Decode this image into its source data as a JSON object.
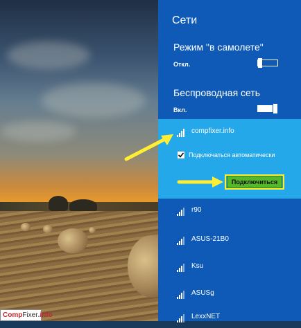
{
  "panel": {
    "title": "Сети",
    "airplane_mode": {
      "label": "Режим \"в самолете\"",
      "state": "Откл."
    },
    "wireless": {
      "label": "Беспроводная сеть",
      "state": "Вкл."
    }
  },
  "selected_network": {
    "name": "compfixer.info",
    "auto_connect_label": "Подключаться автоматически",
    "auto_connect_checked": true,
    "connect_button": "Подключиться"
  },
  "networks": [
    {
      "name": "r90"
    },
    {
      "name": "ASUS-21B0"
    },
    {
      "name": "Ksu"
    },
    {
      "name": "ASUSg"
    },
    {
      "name": "LexxNET"
    }
  ],
  "watermark": {
    "part1": "Comp",
    "part2": "Fixer",
    "part3": ".info"
  },
  "colors": {
    "panel": "#0f5ab6",
    "selected": "#24a8ea",
    "button": "#55b72a",
    "arrow": "#ffee33"
  }
}
